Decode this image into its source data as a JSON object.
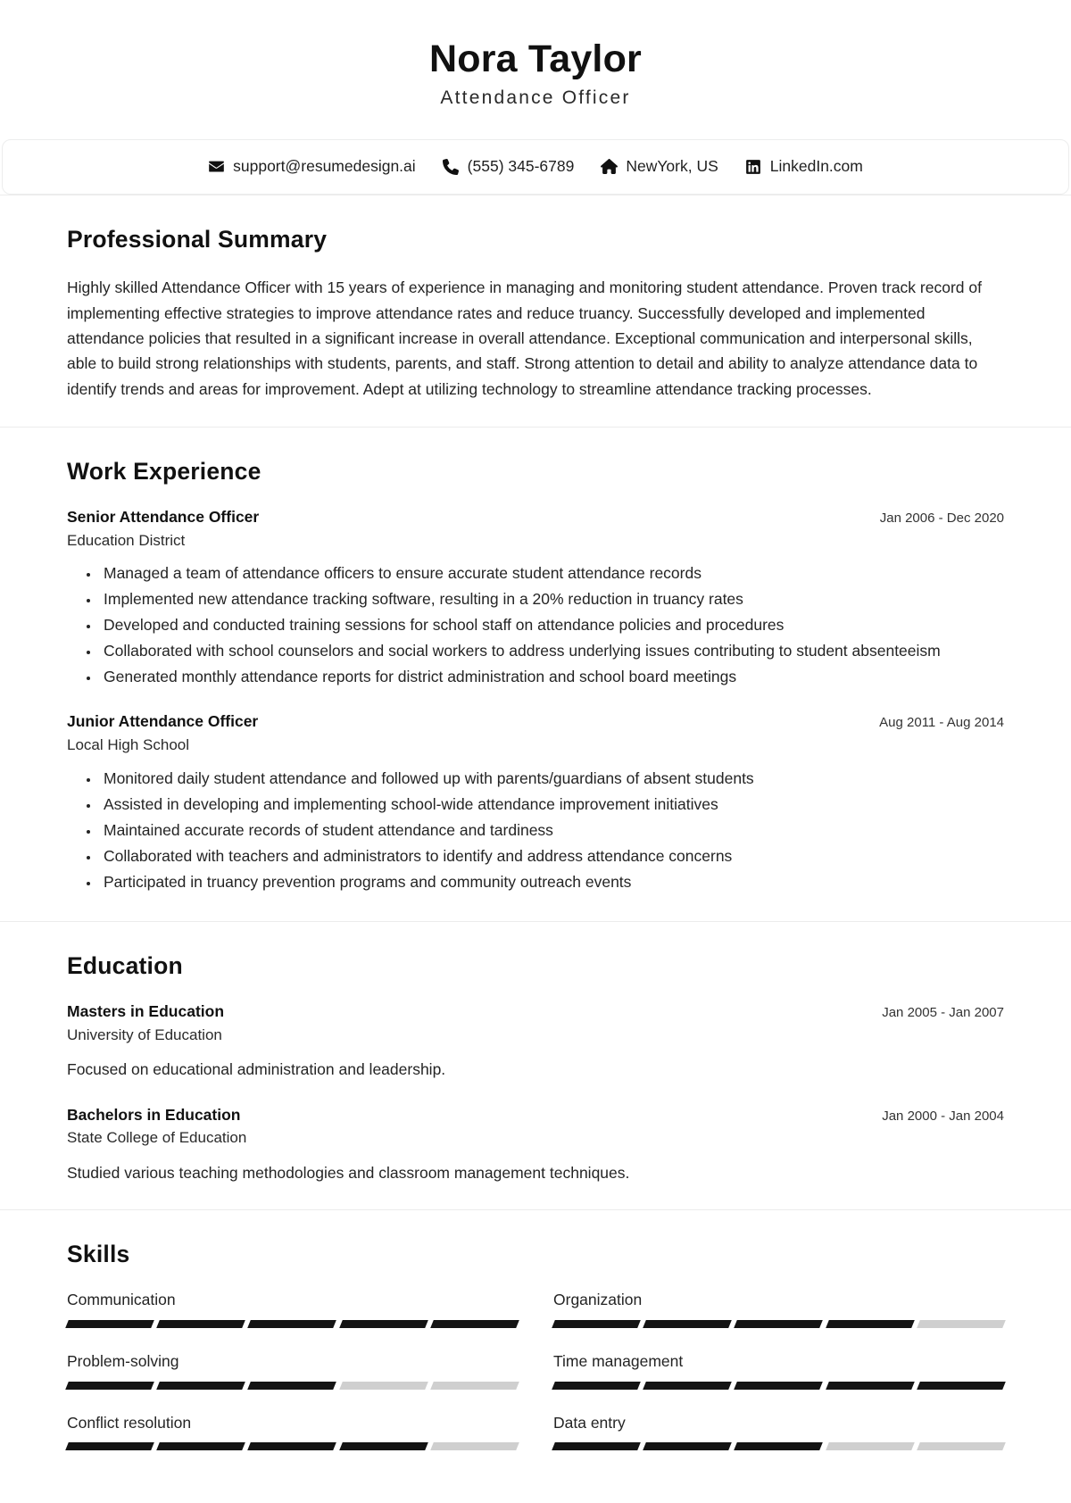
{
  "header": {
    "name": "Nora Taylor",
    "title": "Attendance Officer"
  },
  "contact": {
    "email": "support@resumedesign.ai",
    "phone": "(555) 345-6789",
    "location": "NewYork, US",
    "linkedin": "LinkedIn.com",
    "icons": {
      "email": "envelope-icon",
      "phone": "phone-icon",
      "location": "home-icon",
      "linkedin": "linkedin-icon"
    }
  },
  "summary": {
    "heading": "Professional Summary",
    "text": "Highly skilled Attendance Officer with 15 years of experience in managing and monitoring student attendance. Proven track record of implementing effective strategies to improve attendance rates and reduce truancy. Successfully developed and implemented attendance policies that resulted in a significant increase in overall attendance. Exceptional communication and interpersonal skills, able to build strong relationships with students, parents, and staff. Strong attention to detail and ability to analyze attendance data to identify trends and areas for improvement. Adept at utilizing technology to streamline attendance tracking processes."
  },
  "work": {
    "heading": "Work Experience",
    "entries": [
      {
        "role": "Senior Attendance Officer",
        "org": "Education District",
        "date": "Jan 2006 - Dec 2020",
        "bullets": [
          "Managed a team of attendance officers to ensure accurate student attendance records",
          "Implemented new attendance tracking software, resulting in a 20% reduction in truancy rates",
          "Developed and conducted training sessions for school staff on attendance policies and procedures",
          "Collaborated with school counselors and social workers to address underlying issues contributing to student absenteeism",
          "Generated monthly attendance reports for district administration and school board meetings"
        ]
      },
      {
        "role": "Junior Attendance Officer",
        "org": "Local High School",
        "date": "Aug 2011 - Aug 2014",
        "bullets": [
          "Monitored daily student attendance and followed up with parents/guardians of absent students",
          "Assisted in developing and implementing school-wide attendance improvement initiatives",
          "Maintained accurate records of student attendance and tardiness",
          "Collaborated with teachers and administrators to identify and address attendance concerns",
          "Participated in truancy prevention programs and community outreach events"
        ]
      }
    ]
  },
  "education": {
    "heading": "Education",
    "entries": [
      {
        "degree": "Masters in Education",
        "school": "University of Education",
        "date": "Jan 2005 - Jan 2007",
        "desc": "Focused on educational administration and leadership."
      },
      {
        "degree": "Bachelors in Education",
        "school": "State College of Education",
        "date": "Jan 2000 - Jan 2004",
        "desc": "Studied various teaching methodologies and classroom management techniques."
      }
    ]
  },
  "skills": {
    "heading": "Skills",
    "total_segments": 5,
    "items": [
      {
        "name": "Communication",
        "level": 5
      },
      {
        "name": "Organization",
        "level": 4
      },
      {
        "name": "Problem-solving",
        "level": 3
      },
      {
        "name": "Time management",
        "level": 5
      },
      {
        "name": "Conflict resolution",
        "level": 4
      },
      {
        "name": "Data entry",
        "level": 3
      }
    ],
    "colors": {
      "filled": "#141414",
      "empty": "#cfcfcf"
    }
  }
}
